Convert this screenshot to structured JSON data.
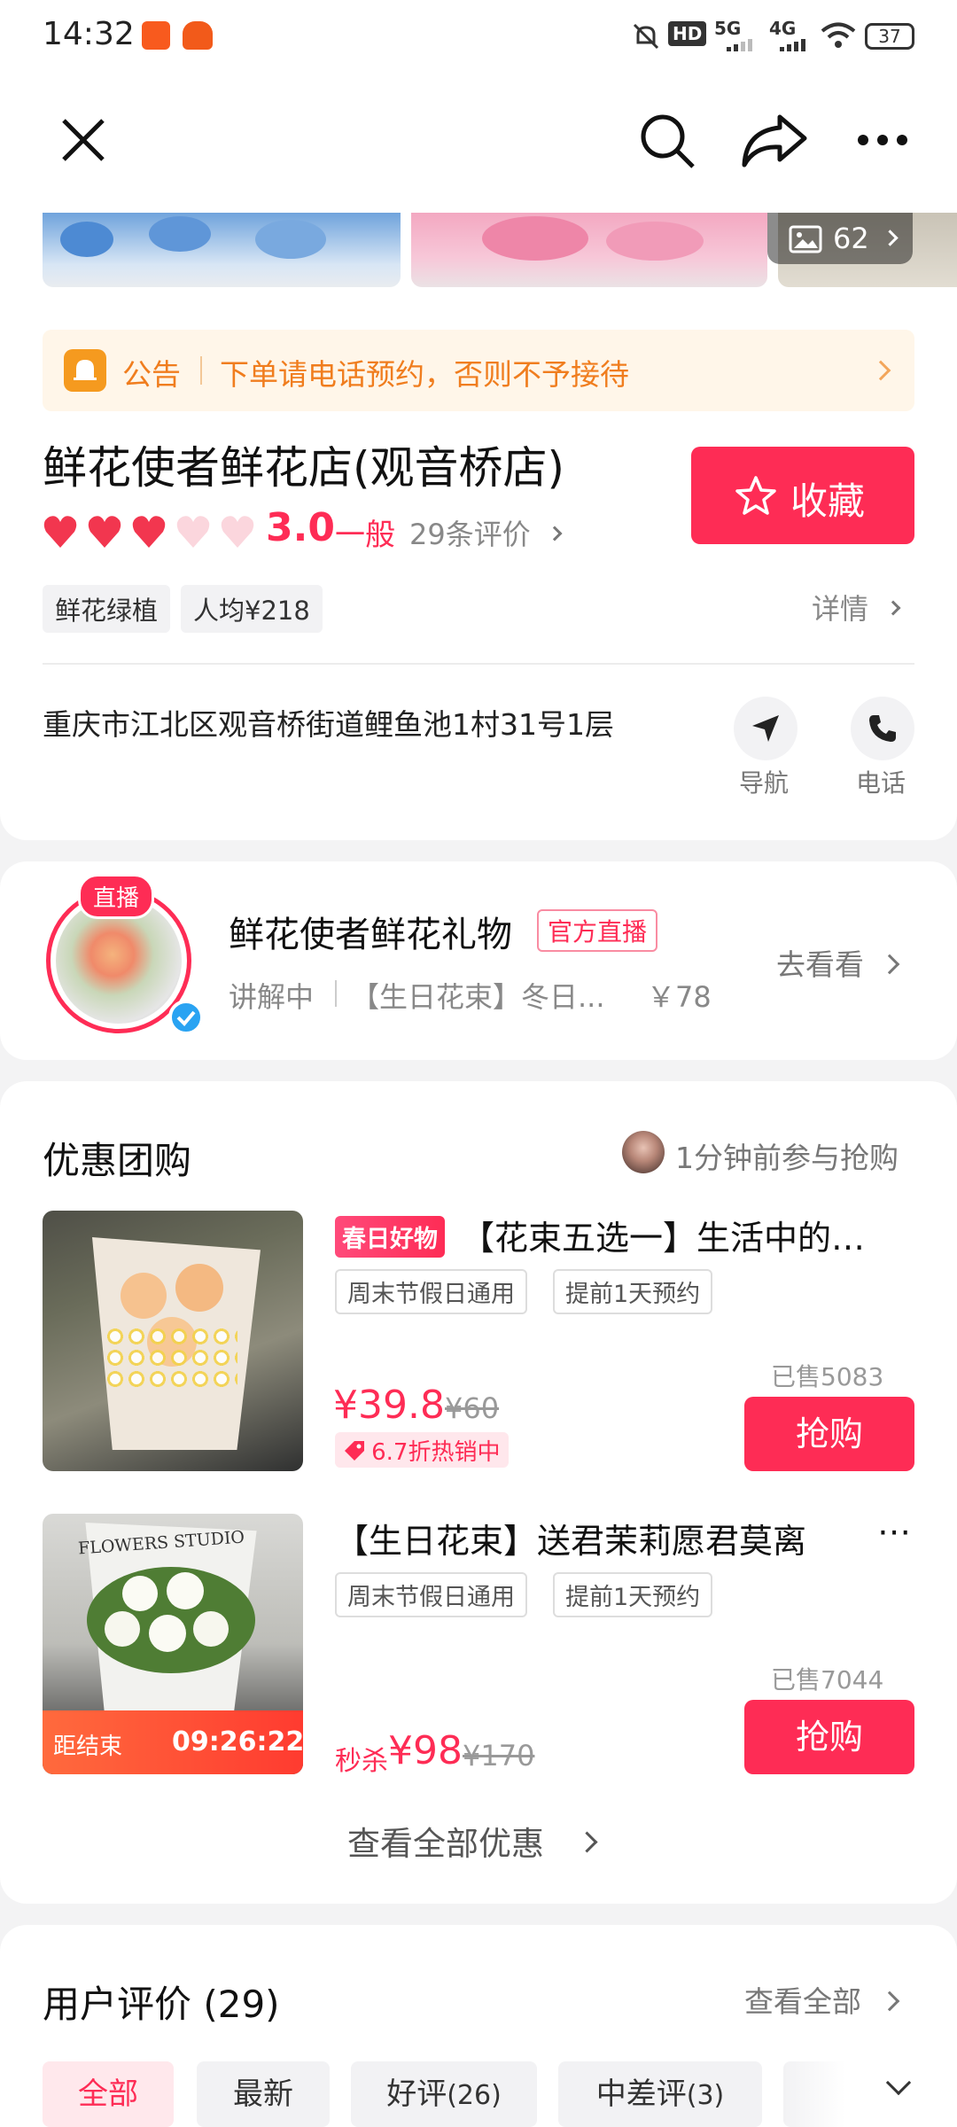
{
  "status": {
    "time": "14:32",
    "network1": "5G",
    "network2": "4G",
    "battery": "37",
    "hd": "HD"
  },
  "topbar": {
    "close_icon": "close-icon",
    "search_icon": "search-icon",
    "share_icon": "share-icon",
    "more_icon": "more-icon"
  },
  "gallery": {
    "count": "62"
  },
  "notice": {
    "label": "公告",
    "text": "下单请电话预约，否则不予接待"
  },
  "shop": {
    "name": "鲜花使者鲜花店(观音桥店)",
    "rating": "3.0",
    "rating_word": "一般",
    "reviews": "29条评价",
    "tags": [
      "鲜花绿植",
      "人均¥218"
    ],
    "detail": "详情",
    "address": "重庆市江北区观音桥街道鲤鱼池1村31号1层",
    "nav_label": "导航",
    "phone_label": "电话",
    "collect_label": "收藏"
  },
  "live": {
    "badge": "直播",
    "name": "鲜花使者鲜花礼物",
    "official": "官方直播",
    "status": "讲解中",
    "product": "【生日花束】冬日...",
    "price": "￥78",
    "goto": "去看看"
  },
  "deals": {
    "title": "优惠团购",
    "recent": "1分钟前参与抢购",
    "items": [
      {
        "badge": "春日好物",
        "title": "【花束五选一】生活中的…",
        "tags": [
          "周末节假日通用",
          "提前1天预约"
        ],
        "price": "¥39.8",
        "orig": "¥60",
        "discount": "6.7折热销中",
        "sold": "已售5083",
        "btn": "抢购"
      },
      {
        "title": "【生日花束】送君茉莉愿君莫离",
        "tags": [
          "周末节假日通用",
          "提前1天预约"
        ],
        "flash": "秒杀",
        "price": "¥98",
        "orig": "¥170",
        "sold": "已售7044",
        "btn": "抢购",
        "countdown_label": "距结束",
        "countdown": "09:26:22",
        "image_text": "FLOWERS STUDIO"
      }
    ],
    "view_all": "查看全部优惠"
  },
  "reviews": {
    "title": "用户评价 (29)",
    "view_all": "查看全部",
    "tabs": [
      {
        "label": "全部",
        "count": ""
      },
      {
        "label": "最新",
        "count": ""
      },
      {
        "label": "好评",
        "count": "(26)"
      },
      {
        "label": "中差评",
        "count": "(3)"
      }
    ]
  },
  "colors": {
    "accent": "#fe2c55",
    "notice_bg": "#fff6e9",
    "notice_text": "#f07d1e"
  }
}
